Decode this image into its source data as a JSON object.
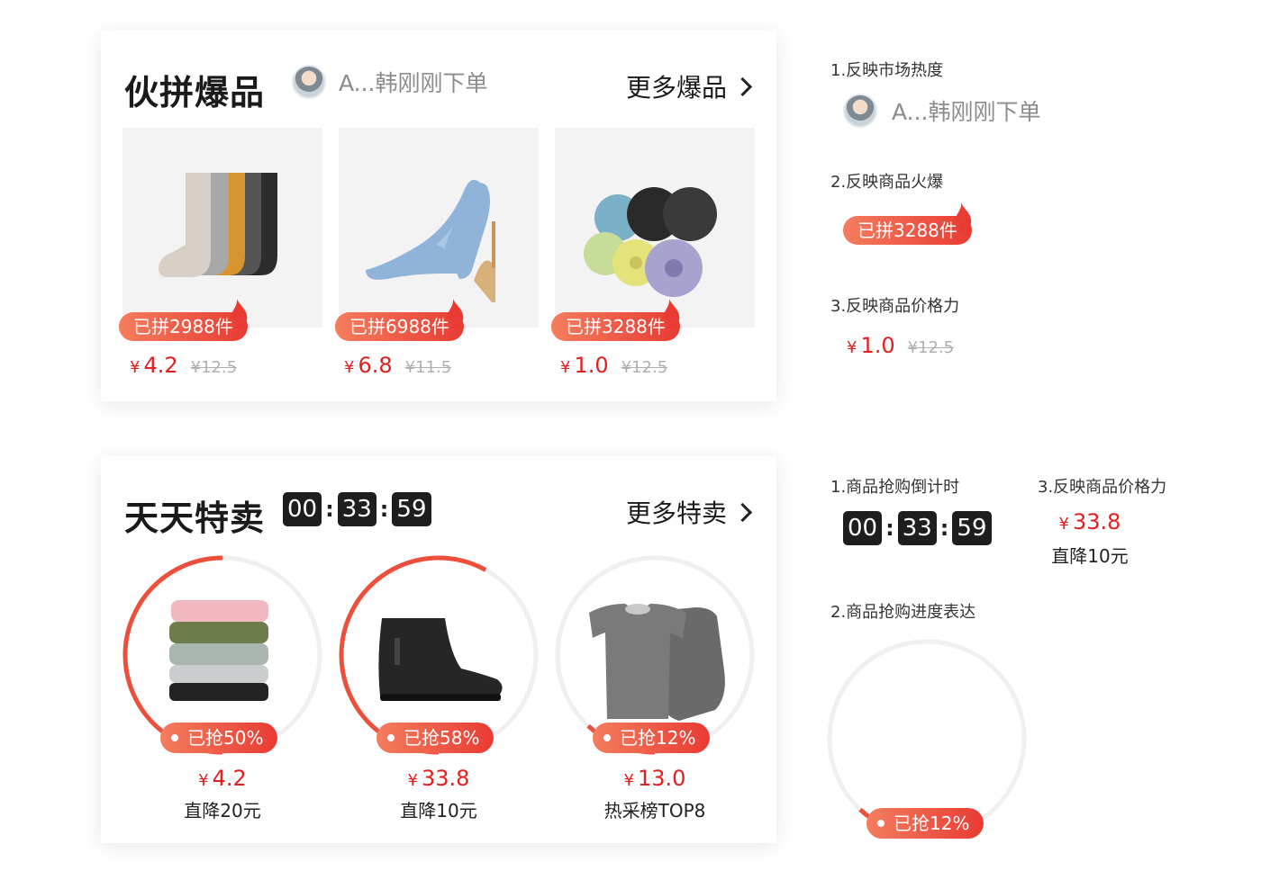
{
  "group_buy": {
    "title": "伙拼爆品",
    "buyer_text": "A...韩刚刚下单",
    "more_label": "更多爆品",
    "items": [
      {
        "name": "socks",
        "badge": "已拼2988件",
        "price": "4.2",
        "currency": "¥",
        "old_price": "¥12.5"
      },
      {
        "name": "heels",
        "badge": "已拼6988件",
        "price": "6.8",
        "currency": "¥",
        "old_price": "¥11.5"
      },
      {
        "name": "garbage-bags",
        "badge": "已拼3288件",
        "price": "1.0",
        "currency": "¥",
        "old_price": "¥12.5"
      }
    ]
  },
  "daily_deals": {
    "title": "天天特卖",
    "timer": {
      "h": "00",
      "m": "33",
      "s": "59"
    },
    "more_label": "更多特卖",
    "items": [
      {
        "name": "towels",
        "badge": "已抢50%",
        "progress": 0.5,
        "price": "4.2",
        "currency": "¥",
        "note": "直降20元"
      },
      {
        "name": "boots",
        "badge": "已抢58%",
        "progress": 0.58,
        "price": "33.8",
        "currency": "¥",
        "note": "直降10元"
      },
      {
        "name": "thermal-wear",
        "badge": "已抢12%",
        "progress": 0.12,
        "price": "13.0",
        "currency": "¥",
        "note": "热采榜TOP8"
      }
    ]
  },
  "annotations": {
    "a1_label": "1.反映市场热度",
    "a1_buyer": "A...韩刚刚下单",
    "a2_label": "2.反映商品火爆",
    "a2_badge": "已拼3288件",
    "a3_label": "3.反映商品价格力",
    "a3_price": "1.0",
    "a3_currency": "¥",
    "a3_old": "¥12.5",
    "b1_label": "1.商品抢购倒计时",
    "b1_timer": {
      "h": "00",
      "m": "33",
      "s": "59"
    },
    "b3_label": "3.反映商品价格力",
    "b3_price": "33.8",
    "b3_currency": "¥",
    "b3_note": "直降10元",
    "b2_label": "2.商品抢购进度表达",
    "b2_badge": "已抢12%",
    "b2_progress": 0.12
  },
  "colors": {
    "accent": "#e0201f",
    "badge_start": "#f47d5e",
    "badge_end": "#e83b33",
    "ring_track": "#f0f0f0",
    "timer_bg": "#1e1e1e"
  }
}
